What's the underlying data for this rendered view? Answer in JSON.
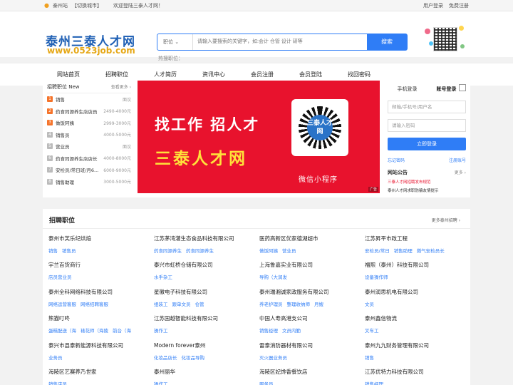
{
  "topbar": {
    "city": "泰州站",
    "switch_city": "【切换城市】",
    "welcome": "欢迎登陆三泰人才网！",
    "user_login": "用户登录",
    "register": "免费注册"
  },
  "header": {
    "logo_cn": "泰州三泰人才网",
    "logo_url": "www.0523job.com",
    "search_select": "职位",
    "search_placeholder": "请输入要搜索的关键字，如:会计 仓管 设计 研等",
    "search_button": "搜索",
    "hot_label": "热搜职位："
  },
  "nav": [
    "网站首页",
    "招聘职位",
    "人才简历",
    "资讯中心",
    "会员注册",
    "会员登陆",
    "找回密码"
  ],
  "jobs_panel": {
    "title": "招聘职位 New",
    "more": "查看更多 ›",
    "items": [
      {
        "n": "1",
        "title": "销售",
        "salary": "面议"
      },
      {
        "n": "2",
        "title": "药食同源养生店店员",
        "salary": "2490-4000元"
      },
      {
        "n": "3",
        "title": "做饭阿姨",
        "salary": "2999-3000元"
      },
      {
        "n": "4",
        "title": "销售员",
        "salary": "4000-5000元"
      },
      {
        "n": "5",
        "title": "营业员",
        "salary": "面议"
      },
      {
        "n": "6",
        "title": "药食同源养生店店长",
        "salary": "4000-8000元"
      },
      {
        "n": "7",
        "title": "安检员/常日班/月6...",
        "salary": "6000-9000元"
      },
      {
        "n": "8",
        "title": "销售助理",
        "salary": "3000-5000元"
      }
    ]
  },
  "banner": {
    "line1": "找工作 招人才",
    "line2": "三泰人才网",
    "qr_text": "三泰人才网",
    "mini_program": "微信小程序",
    "ad": "广告"
  },
  "login": {
    "tab_phone": "手机登录",
    "tab_account": "账号登录",
    "user_placeholder": "邮箱/手机号/用户名",
    "pass_placeholder": "请输入密码",
    "login_button": "立即登录",
    "forgot": "忘记密码",
    "register": "注册账号",
    "notice_title": "网站公告",
    "notice_more": "更多 ›",
    "notices": [
      "三泰人才网招聘发布规范",
      "泰州人才网求职防骗友情提示"
    ]
  },
  "list": {
    "title": "招聘职位",
    "more": "更多泰州招聘 ›",
    "companies": [
      {
        "name": "泰州市芙乐纪烘焙",
        "tags": [
          "销售",
          "销售员"
        ]
      },
      {
        "name": "江苏茅湾灌生态食品科技有限公司",
        "tags": [
          "药食同源养生",
          "药食同源养生"
        ]
      },
      {
        "name": "医药高新区优家德湖超市",
        "tags": [
          "做饭阿姨",
          "营业员"
        ]
      },
      {
        "name": "江苏昇平市政工程",
        "tags": [
          "安检员/常日",
          "销售助理",
          "燃气安检员长"
        ]
      },
      {
        "name": "宇兰百货商行",
        "tags": [
          "店员营业员"
        ]
      },
      {
        "name": "泰兴市虹桥仓储有限公司",
        "tags": [
          "水手杂工"
        ]
      },
      {
        "name": "上海鲁嘉实业有限公司",
        "tags": [
          "导购（大润发"
        ]
      },
      {
        "name": "福熙（泰州）科技有限公司",
        "tags": [
          "设备操作师"
        ]
      },
      {
        "name": "泰州全科网络科技有限公司",
        "tags": [
          "网络运营客服",
          "网络招聘客服"
        ]
      },
      {
        "name": "星徽电子科技有限公司",
        "tags": [
          "组装工",
          "跟单文员",
          "仓管"
        ]
      },
      {
        "name": "泰州瑞湘诚家政服务有限公司",
        "tags": [
          "养老护理员",
          "整理收纳师",
          "月嫂"
        ]
      },
      {
        "name": "泰州润思机电有限公司",
        "tags": [
          "文员"
        ]
      },
      {
        "name": "熊猫叮咚",
        "tags": [
          "蛋糕配送（海",
          "裱花师（海陵",
          "前台（海"
        ]
      },
      {
        "name": "江苏国越智能科技有限公司",
        "tags": [
          "操作工"
        ]
      },
      {
        "name": "中国人寿高港支公司",
        "tags": [
          "销售经理",
          "文员内勤"
        ]
      },
      {
        "name": "泰州鑫信物流",
        "tags": [
          "叉车工"
        ]
      },
      {
        "name": "泰兴市县泰新能源科技有限公司",
        "tags": [
          "业务员"
        ]
      },
      {
        "name": "Modern forever泰州",
        "tags": [
          "化妆品店长",
          "化妆品导购"
        ]
      },
      {
        "name": "雷泰消防器材有限公司",
        "tags": [
          "灭火器业务员"
        ]
      },
      {
        "name": "泰州九九财务管理有限公司",
        "tags": [
          "销售"
        ]
      },
      {
        "name": "海陵区艺赛养乃世家",
        "tags": [
          "销售店员"
        ]
      },
      {
        "name": "泰州丽华",
        "tags": [
          "操作工"
        ]
      },
      {
        "name": "海陵区妃馋香餐饮店",
        "tags": [
          "服务员"
        ]
      },
      {
        "name": "江苏优特力科技有限公司",
        "tags": [
          "销售经理"
        ]
      }
    ]
  },
  "colors": {
    "brand": "#2f7df6",
    "logo": "#1e5fb4",
    "url": "#e6a817",
    "banner": "#e8122d"
  }
}
